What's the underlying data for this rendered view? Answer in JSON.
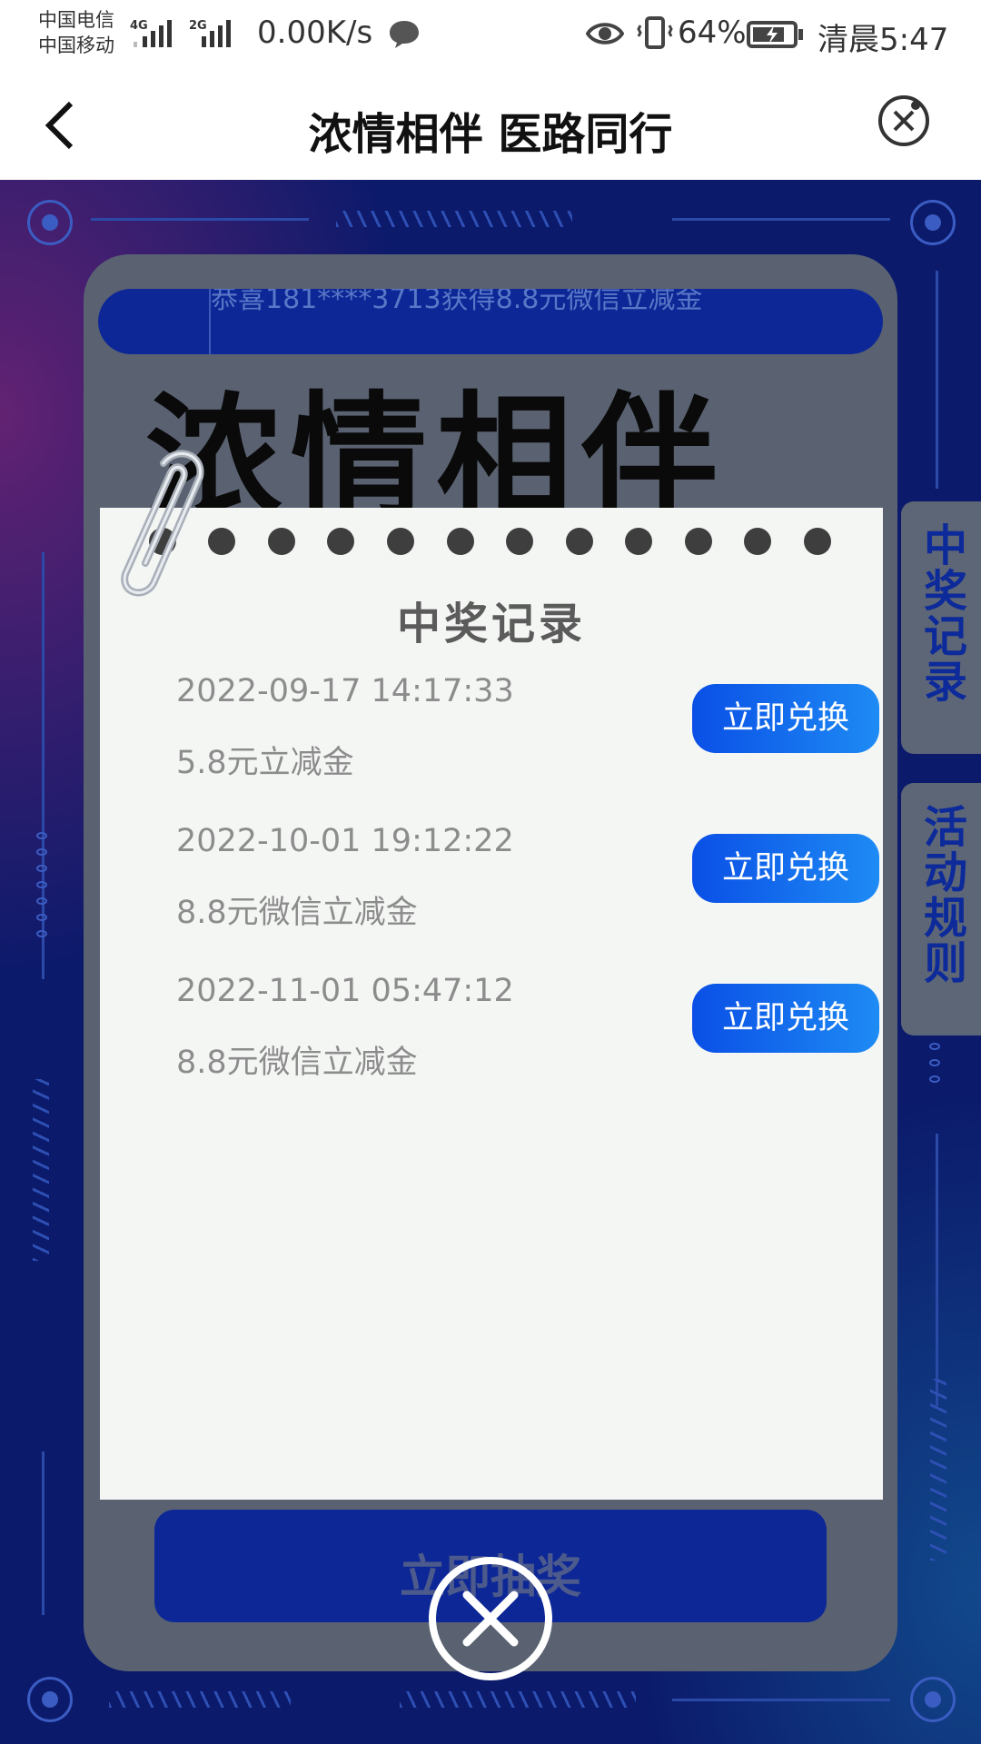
{
  "status_bar": {
    "carrier_1": "中国电信",
    "carrier_2": "中国移动",
    "net_1": "4G",
    "net_2": "2G",
    "net_speed": "0.00K/s",
    "battery": "64%",
    "time": "清晨5:47"
  },
  "title_bar": {
    "title": "浓情相伴 医路同行",
    "back_icon": "chevron-left-icon",
    "close_icon": "close-circle-icon"
  },
  "background": {
    "ticker": "恭喜181****3713获得8.8元微信立减金",
    "big_title": "浓情相伴",
    "draw_button": "立即抽奖"
  },
  "side_tabs": [
    {
      "label": "中奖记录"
    },
    {
      "label": "活动规则"
    }
  ],
  "popup": {
    "title": "中奖记录",
    "records": [
      {
        "time": "2022-09-17 14:17:33",
        "prize": "5.8元立减金",
        "button": "立即兑换"
      },
      {
        "time": "2022-10-01 19:12:22",
        "prize": "8.8元微信立减金",
        "button": "立即兑换"
      },
      {
        "time": "2022-11-01 05:47:12",
        "prize": "8.8元微信立减金",
        "button": "立即兑换"
      }
    ],
    "close_icon": "close-circle-icon"
  },
  "colors": {
    "background_blue": "#0b1a6b",
    "button_blue": "#0a4fe6",
    "card": "#f4f6f4"
  }
}
